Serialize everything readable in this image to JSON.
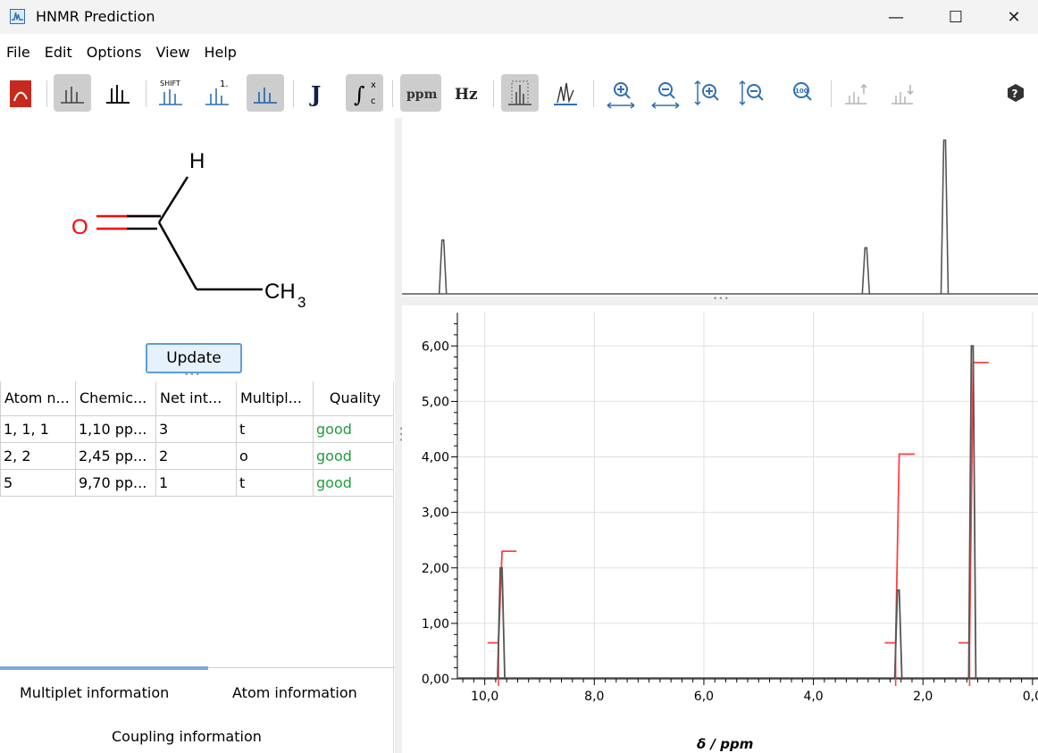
{
  "window": {
    "title": "HNMR Prediction",
    "minimize_glyph": "—",
    "maximize_glyph": "☐",
    "close_glyph": "✕"
  },
  "menu": [
    "File",
    "Edit",
    "Options",
    "View",
    "Help"
  ],
  "toolbar": {
    "shift_label": "SHIFT",
    "one_label": "1.",
    "j_label": "J",
    "integral_label": "∫",
    "integral_sup": "x",
    "integral_sub": "c",
    "ppm_label": "ppm",
    "hz_label": "Hz",
    "zoom_100_label": "100",
    "help_label": "?"
  },
  "molecule": {
    "atom_o": "O",
    "atom_h": "H",
    "atom_ch": "CH",
    "atom_ch_sub": "3"
  },
  "update_button": "Update",
  "table": {
    "columns": [
      "Atom n...",
      "Chemic...",
      "Net int...",
      "Multipl...",
      "Quality"
    ],
    "rows": [
      [
        "1, 1, 1",
        "1,10 pp...",
        "3",
        "t",
        "good"
      ],
      [
        "2, 2",
        "2,45 pp...",
        "2",
        "o",
        "good"
      ],
      [
        "5",
        "9,70 pp...",
        "1",
        "t",
        "good"
      ]
    ]
  },
  "tabs": {
    "multiplet": "Multiplet information",
    "atom": "Atom information",
    "coupling": "Coupling information"
  },
  "colors": {
    "accent": "#5e9ed6",
    "good": "#1f9d3a",
    "oxygen": "#ff0000",
    "spectrum": "#555555",
    "integral": "#ff4040",
    "grid": "#e0e0e0"
  },
  "chart_data": {
    "type": "line",
    "xlabel": "δ / ppm",
    "ylabel": "",
    "xlim": [
      10.5,
      -0.1
    ],
    "ylim": [
      0,
      6.6
    ],
    "x_ticks": [
      10,
      8,
      6,
      4,
      2,
      0
    ],
    "x_tick_labels": [
      "10,0",
      "8,0",
      "6,0",
      "4,0",
      "2,0",
      "0,0"
    ],
    "y_ticks": [
      0,
      1,
      2,
      3,
      4,
      5,
      6
    ],
    "y_tick_labels": [
      "0,00",
      "1,00",
      "2,00",
      "3,00",
      "4,00",
      "5,00",
      "6,00"
    ],
    "grid": true,
    "series": [
      {
        "kind": "spectrum",
        "peaks": [
          {
            "x": 9.7,
            "y": 2.0
          },
          {
            "x": 2.45,
            "y": 1.6
          },
          {
            "x": 1.1,
            "y": 6.0
          }
        ]
      },
      {
        "kind": "integral",
        "steps": [
          {
            "x_start": 9.95,
            "x_end": 9.42,
            "y_low": 0.65,
            "y_high": 2.3
          },
          {
            "x_start": 2.7,
            "x_end": 2.15,
            "y_low": 0.65,
            "y_high": 4.05
          },
          {
            "x_start": 1.35,
            "x_end": 0.8,
            "y_low": 0.65,
            "y_high": 5.7
          }
        ]
      }
    ],
    "overview": {
      "xlim": [
        10.4,
        -0.5
      ],
      "peaks": [
        {
          "x": 9.7,
          "y": 0.35
        },
        {
          "x": 2.45,
          "y": 0.3
        },
        {
          "x": 1.1,
          "y": 1.0
        }
      ]
    }
  }
}
